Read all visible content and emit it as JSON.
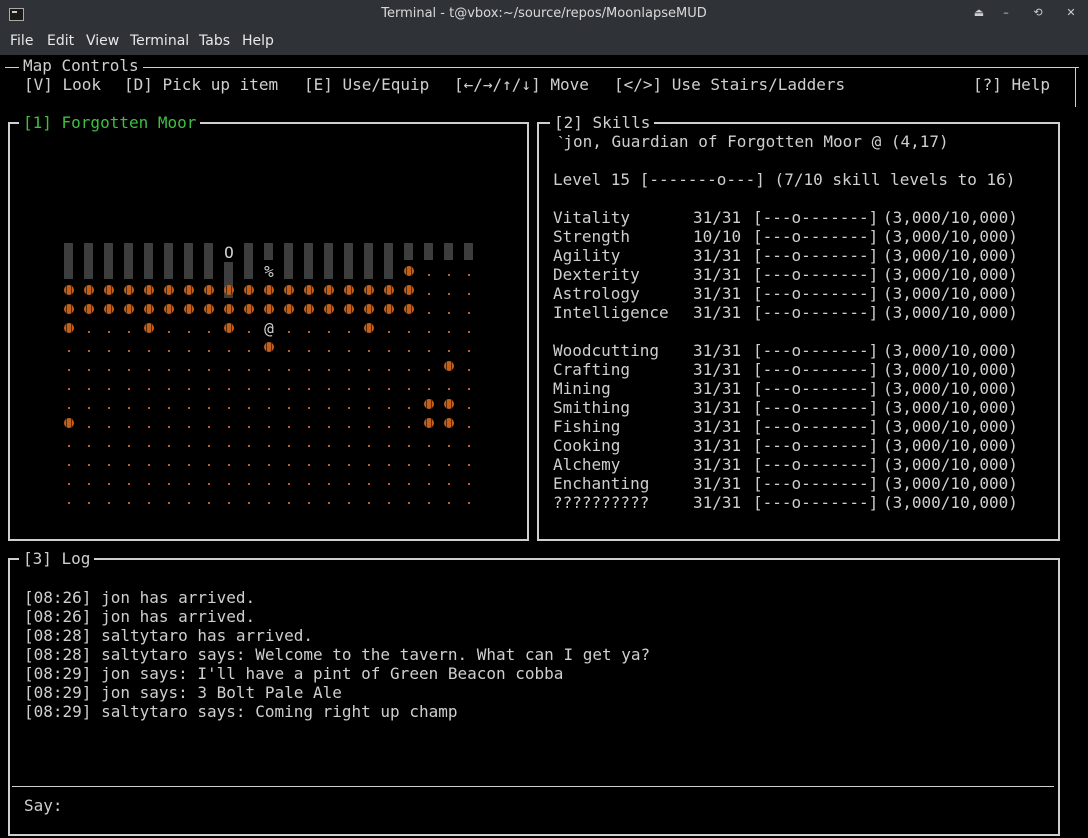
{
  "window": {
    "title": "Terminal - t@vbox:~/source/repos/MoonlapseMUD",
    "buttons": [
      "⏏",
      "–",
      "⟲",
      "✕"
    ]
  },
  "menu": [
    "File",
    "Edit",
    "View",
    "Terminal",
    "Tabs",
    "Help"
  ],
  "controls": {
    "title": "Map Controls",
    "items": [
      "[V] Look",
      "[D] Pick up item",
      "[E] Use/Equip",
      "[←/→/↑/↓] Move",
      "[</>] Use Stairs/Ladders",
      "[?] Help"
    ]
  },
  "map": {
    "title": "[1] Forgotten Moor",
    "glyphs": {
      "O": "O",
      "percent": "%",
      "player": "@"
    }
  },
  "skills": {
    "title": "[2] Skills",
    "header": "ˋjon, Guardian of Forgotten Moor @ (4,17)",
    "level": "Level 15 [-------o---] (7/10 skill levels to 16)",
    "group1": [
      [
        "Vitality",
        "31/31",
        "[---o-------]",
        "(3,000/10,000)"
      ],
      [
        "Strength",
        "10/10",
        "[---o-------]",
        "(3,000/10,000)"
      ],
      [
        "Agility",
        "31/31",
        "[---o-------]",
        "(3,000/10,000)"
      ],
      [
        "Dexterity",
        "31/31",
        "[---o-------]",
        "(3,000/10,000)"
      ],
      [
        "Astrology",
        "31/31",
        "[---o-------]",
        "(3,000/10,000)"
      ],
      [
        "Intelligence",
        "31/31",
        "[---o-------]",
        "(3,000/10,000)"
      ]
    ],
    "group2": [
      [
        "Woodcutting",
        "31/31",
        "[---o-------]",
        "(3,000/10,000)"
      ],
      [
        "Crafting",
        "31/31",
        "[---o-------]",
        "(3,000/10,000)"
      ],
      [
        "Mining",
        "31/31",
        "[---o-------]",
        "(3,000/10,000)"
      ],
      [
        "Smithing",
        "31/31",
        "[---o-------]",
        "(3,000/10,000)"
      ],
      [
        "Fishing",
        "31/31",
        "[---o-------]",
        "(3,000/10,000)"
      ],
      [
        "Cooking",
        "31/31",
        "[---o-------]",
        "(3,000/10,000)"
      ],
      [
        "Alchemy",
        "31/31",
        "[---o-------]",
        "(3,000/10,000)"
      ],
      [
        "Enchanting",
        "31/31",
        "[---o-------]",
        "(3,000/10,000)"
      ],
      [
        "??????????",
        "31/31",
        "[---o-------]",
        "(3,000/10,000)"
      ]
    ]
  },
  "log": {
    "title": "[3] Log",
    "lines": [
      "[08:26] jon has arrived.",
      "[08:26] jon has arrived.",
      "[08:28] saltytaro has arrived.",
      "[08:28] saltytaro says: Welcome to the tavern. What can I get ya?",
      "[08:29] jon says: I'll have a pint of Green Beacon cobba",
      "[08:29] jon says: 3 Bolt Pale Ale",
      "[08:29] saltytaro says: Coming right up champ"
    ]
  },
  "say": {
    "label": "Say:",
    "value": ""
  }
}
